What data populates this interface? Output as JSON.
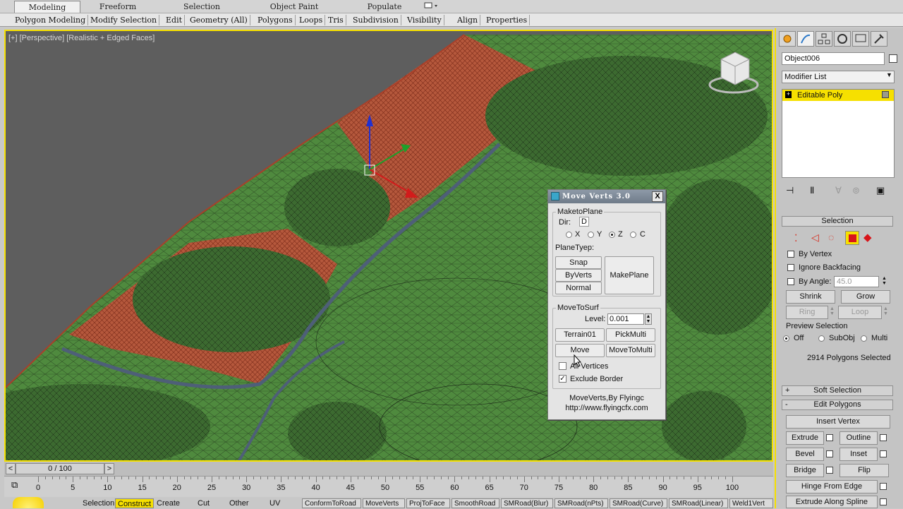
{
  "ribbon": {
    "tabs": [
      "Modeling",
      "Freeform",
      "Selection",
      "Object Paint",
      "Populate"
    ],
    "active_tab": "Modeling",
    "menu_items": [
      "Polygon Modeling",
      "Modify Selection",
      "Edit",
      "Geometry (All)",
      "Polygons",
      "Loops",
      "Tris",
      "Subdivision",
      "Visibility",
      "Align",
      "Properties"
    ]
  },
  "viewport": {
    "label": "[+] [Perspective] [Realistic + Edged Faces]"
  },
  "dialog": {
    "title": "Move Verts 3.0",
    "close_label": "X",
    "make_to_plane": {
      "group_label": "MaketoPlane",
      "dir_label": "Dir:",
      "dir_value": "D",
      "axes": [
        "X",
        "Y",
        "Z",
        "C"
      ],
      "selected_axis": "Z",
      "plane_type_label": "PlaneTyep:",
      "snap": "Snap",
      "by_verts": "ByVerts",
      "normal": "Normal",
      "make_plane": "MakePlane"
    },
    "move_to_surf": {
      "group_label": "MoveToSurf",
      "level_label": "Level:",
      "level_value": "0.001",
      "terrain": "Terrain01",
      "pick_multi": "PickMulti",
      "move": "Move",
      "move_to_multi": "MoveToMulti",
      "all_vertices": "All Vertices",
      "all_vertices_checked": false,
      "exclude_border": "Exclude Border",
      "exclude_border_checked": true
    },
    "credit": "MoveVerts,By Flyingc",
    "url": "http://www.flyingcfx.com"
  },
  "command_panel": {
    "object_name": "Object006",
    "modifier_list": "Modifier List",
    "stack_item": "Editable Poly",
    "selection": {
      "header": "Selection",
      "by_vertex": "By Vertex",
      "ignore_backfacing": "Ignore Backfacing",
      "by_angle": "By Angle:",
      "angle_value": "45.0",
      "shrink": "Shrink",
      "grow": "Grow",
      "ring": "Ring",
      "loop": "Loop",
      "preview_label": "Preview Selection",
      "preview_options": [
        "Off",
        "SubObj",
        "Multi"
      ],
      "preview_selected": "Off",
      "status": "2914 Polygons Selected"
    },
    "soft_selection": "Soft Selection",
    "edit_polygons": {
      "header": "Edit Polygons",
      "insert_vertex": "Insert Vertex",
      "extrude": "Extrude",
      "outline": "Outline",
      "bevel": "Bevel",
      "inset": "Inset",
      "bridge": "Bridge",
      "flip": "Flip",
      "hinge": "Hinge From Edge",
      "extrude_spline": "Extrude Along Spline"
    }
  },
  "timeline": {
    "frame_display": "0 / 100",
    "ticks": [
      "0",
      "5",
      "10",
      "15",
      "20",
      "25",
      "30",
      "35",
      "40",
      "45",
      "50",
      "55",
      "60",
      "65",
      "70",
      "75",
      "80",
      "85",
      "90",
      "95",
      "100"
    ]
  },
  "bottom": {
    "tabs": [
      "Selection",
      "Construct",
      "Create",
      "Cut",
      "Other",
      "UV"
    ],
    "active_tab": "Construct",
    "tools": [
      "ConformToRoad",
      "MoveVerts",
      "ProjToFace",
      "SmoothRoad",
      "SMRoad(Blur)",
      "SMRoad(nPts)",
      "SMRoad(Curve)",
      "SMRoad(Linear)",
      "Weld1Vert"
    ]
  },
  "colors": {
    "viewport_border": "#f6e000",
    "terrain_green": "#4f8a3e",
    "selected_faces": "#c9553a",
    "stack_highlight": "#f6e000"
  }
}
